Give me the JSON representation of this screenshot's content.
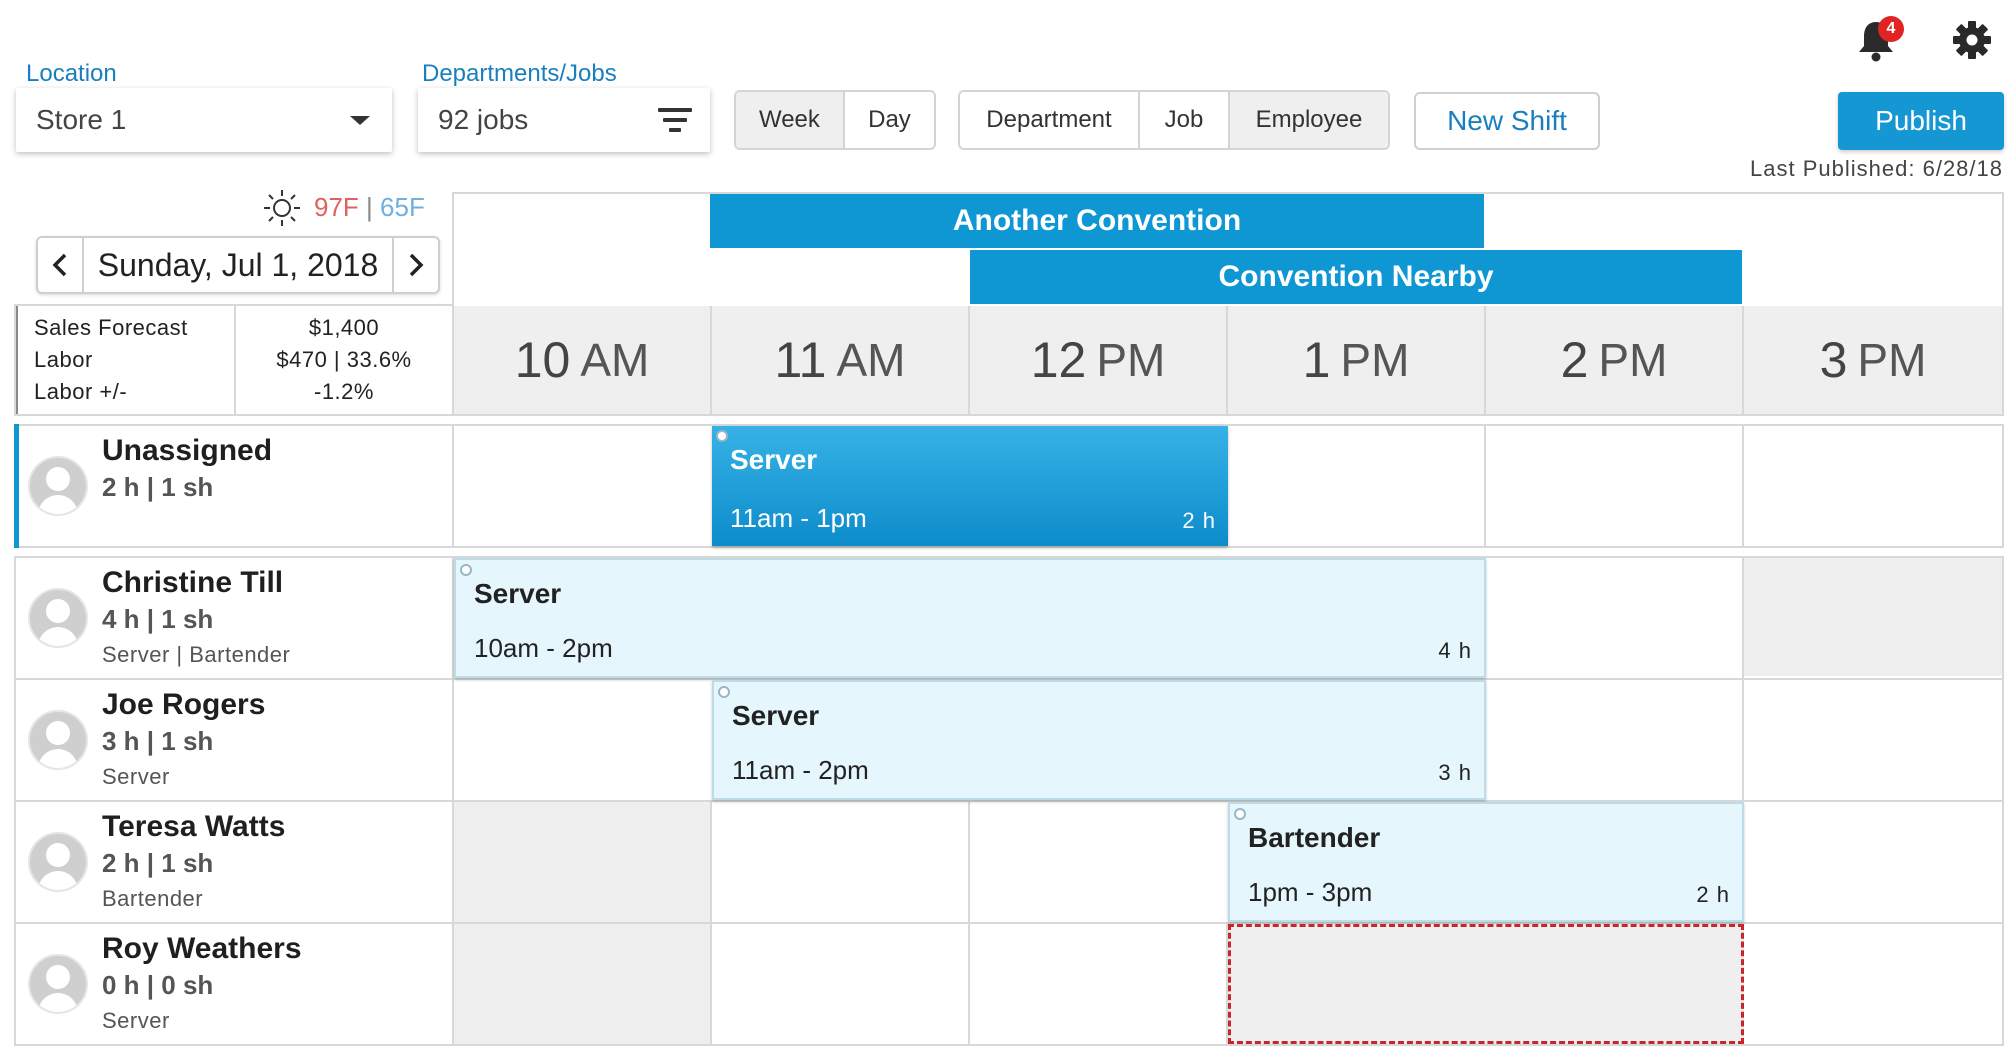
{
  "header": {
    "location_label": "Location",
    "location_value": "Store 1",
    "departments_label": "Departments/Jobs",
    "departments_value": "92 jobs",
    "view_toggle": [
      "Week",
      "Day"
    ],
    "view_active": "Week",
    "group_toggle": [
      "Department",
      "Job",
      "Employee"
    ],
    "group_active": "Employee",
    "new_shift_label": "New Shift",
    "publish_label": "Publish",
    "last_published": "Last Published: 6/28/18",
    "notification_count": "4"
  },
  "icons": {
    "notifications": "bell-icon",
    "settings": "gear-icon",
    "weather": "sun-icon",
    "prev": "chevron-left-icon",
    "next": "chevron-right-icon",
    "dropdown": "caret-down-icon",
    "filter": "filter-icon",
    "avatar": "person-icon"
  },
  "weather": {
    "high": "97F",
    "separator": "|",
    "low": "65F",
    "high_color": "#e0625c",
    "low_color": "#6fb0e0"
  },
  "date_nav": {
    "date": "Sunday, Jul 1, 2018",
    "prev": "‹",
    "next": "›"
  },
  "events": [
    {
      "name": "Another Convention"
    },
    {
      "name": "Convention Nearby"
    }
  ],
  "summary": {
    "labels": [
      "Sales Forecast",
      "Labor",
      "Labor +/-"
    ],
    "values": [
      "$1,400",
      "$470 | 33.6%",
      "-1.2%"
    ]
  },
  "hours": [
    {
      "num": "10",
      "ampm": "AM"
    },
    {
      "num": "11",
      "ampm": "AM"
    },
    {
      "num": "12",
      "ampm": "PM"
    },
    {
      "num": "1",
      "ampm": "PM"
    },
    {
      "num": "2",
      "ampm": "PM"
    },
    {
      "num": "3",
      "ampm": "PM"
    }
  ],
  "employees": [
    {
      "name": "Unassigned",
      "hours": "2 h | 1 sh",
      "jobs": ""
    },
    {
      "name": "Christine Till",
      "hours": "4 h | 1 sh",
      "jobs": "Server | Bartender"
    },
    {
      "name": "Joe Rogers",
      "hours": "3 h | 1 sh",
      "jobs": "Server"
    },
    {
      "name": "Teresa Watts",
      "hours": "2 h | 1 sh",
      "jobs": "Bartender"
    },
    {
      "name": "Roy Weathers",
      "hours": "0 h | 0 sh",
      "jobs": "Server"
    }
  ],
  "shifts": [
    {
      "job": "Server",
      "time": "11am - 1pm",
      "duration": "2 h"
    },
    {
      "job": "Server",
      "time": "10am - 2pm",
      "duration": "4 h"
    },
    {
      "job": "Server",
      "time": "11am - 2pm",
      "duration": "3 h"
    },
    {
      "job": "Bartender",
      "time": "1pm - 3pm",
      "duration": "2 h"
    }
  ],
  "colors": {
    "accent": "#0f97d4",
    "link": "#1a7fbf",
    "shift_light": "#e6f6fd",
    "unavailable": "#efefef",
    "drop_target": "#c8262b"
  }
}
